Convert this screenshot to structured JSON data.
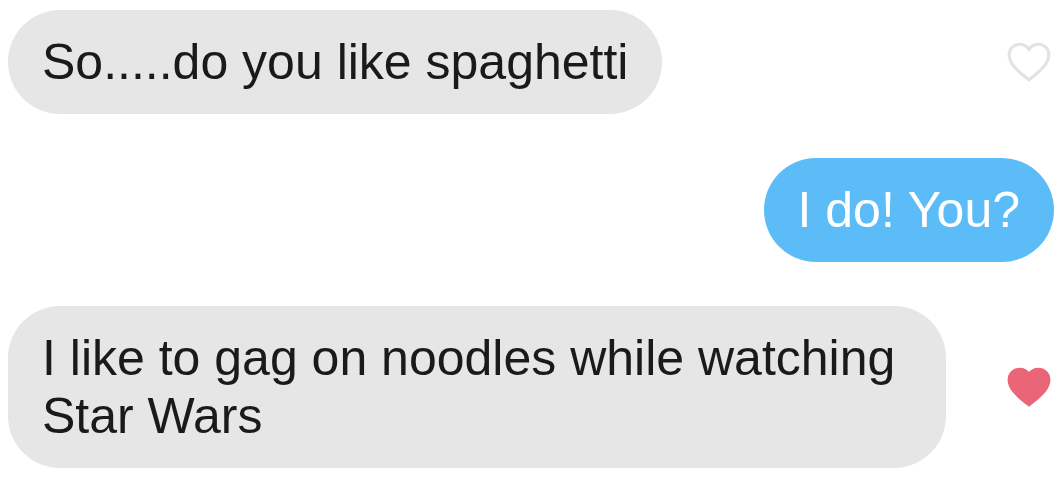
{
  "messages": [
    {
      "text": "So.....do you like spaghetti",
      "kind": "received",
      "liked": false
    },
    {
      "text": "I do! You?",
      "kind": "sent"
    },
    {
      "text": "I like to gag on noodles while watching Star Wars",
      "kind": "received",
      "liked": true
    }
  ]
}
